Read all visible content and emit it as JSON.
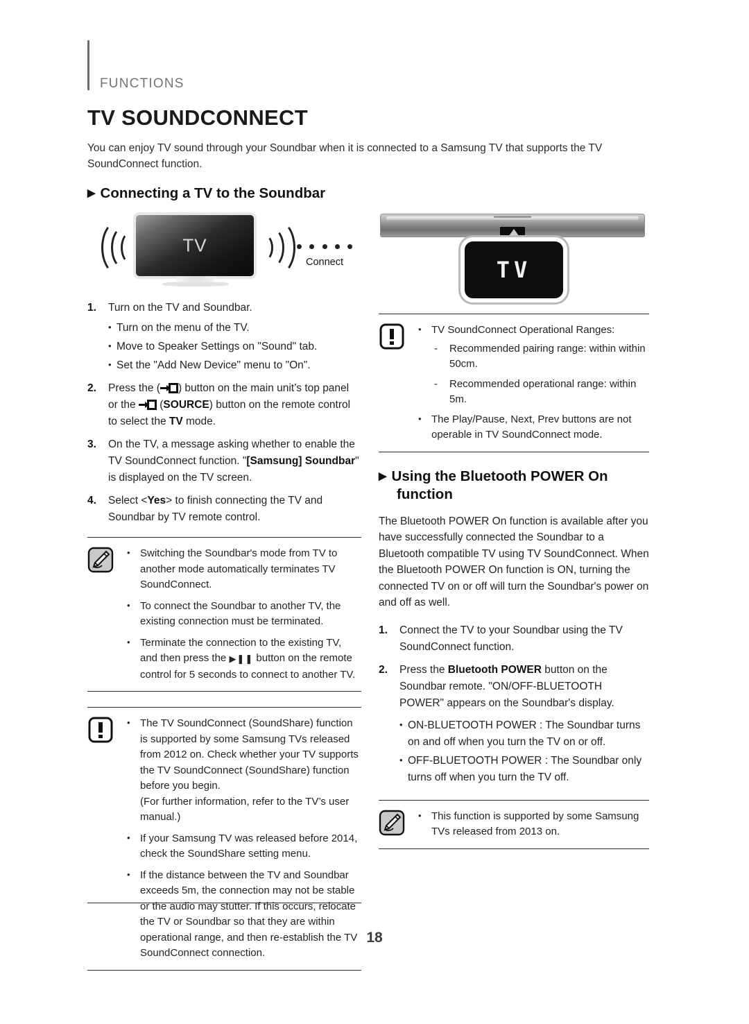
{
  "header": {
    "section_label": "FUNCTIONS",
    "page_title": "TV SOUNDCONNECT",
    "intro": "You can enjoy TV sound through your Soundbar when it is connected to a Samsung TV that supports the TV SoundConnect function."
  },
  "sections": {
    "connecting": {
      "heading": "Connecting a TV to the Soundbar"
    },
    "bluetooth_power": {
      "heading_line1": "Using the Bluetooth POWER On",
      "heading_line2": "function",
      "paragraph": "The Bluetooth POWER On function is available after you have successfully connected the Soundbar to a Bluetooth compatible TV using TV SoundConnect. When the Bluetooth POWER On function is ON, turning the connected TV on or off will turn the Soundbar's power on and off as well."
    }
  },
  "illustrations": {
    "tv": {
      "screen_label": "TV",
      "connect_label": "Connect",
      "dots_count": 5
    },
    "soundbar": {
      "display_text": "TV"
    }
  },
  "left_steps": [
    {
      "num": "1.",
      "text": "Turn on the TV and Soundbar.",
      "subs": [
        "Turn on the menu of the TV.",
        "Move to Speaker Settings on \"Sound\" tab.",
        "Set the \"Add New Device\" menu to \"On\"."
      ]
    },
    {
      "num": "2.",
      "text_part1": "Press the (",
      "text_part2": ") button on the main unit’s top panel or the ",
      "text_part3": " (",
      "bold_source": "SOURCE",
      "text_part4": ") button on the remote control to select the ",
      "bold_tv": "TV",
      "text_part5": " mode."
    },
    {
      "num": "3.",
      "text_part1": "On the TV, a message asking whether to enable the TV SoundConnect function. \"",
      "bold1": "[Samsung] Soundbar",
      "text_part2": "\" is displayed on the TV screen."
    },
    {
      "num": "4.",
      "text_part1": "Select <",
      "bold1": "Yes",
      "text_part2": "> to finish connecting the TV and Soundbar by TV remote control."
    }
  ],
  "left_note": {
    "icon": "note-pencil-icon",
    "bullets": [
      "Switching the Soundbar's mode from TV to another mode automatically terminates TV SoundConnect.",
      "To connect the Soundbar to another TV, the existing connection must be terminated."
    ],
    "bullet3_part1": "Terminate the connection to the existing TV, and then press the ",
    "bullet3_symbol": "▶⏸",
    "bullet3_part2": " button on the remote control for 5 seconds to connect to another TV."
  },
  "left_caution": {
    "icon": "caution-exclamation-icon",
    "bullets": [
      "The TV SoundConnect (SoundShare) function is supported by some Samsung TVs released from 2012 on. Check whether your TV supports the TV SoundConnect (SoundShare) function before you begin.",
      "If your Samsung TV was released before 2014, check the SoundShare setting menu.",
      "If the distance between the TV and Soundbar exceeds 5m, the connection may not be stable or the audio may stutter. If this occurs, relocate the TV or Soundbar so that they are within operational range, and then re-establish the TV SoundConnect connection."
    ],
    "bullet1_extra_line": "(For further information, refer to the TV’s user manual.)"
  },
  "right_caution": {
    "icon": "caution-exclamation-icon",
    "bullet1": "TV SoundConnect Operational Ranges:",
    "dashes": [
      "Recommended pairing range: within within 50cm.",
      "Recommended operational range: within 5m."
    ],
    "bullet2": "The Play/Pause, Next, Prev buttons are not operable in TV SoundConnect mode."
  },
  "right_steps": [
    {
      "num": "1.",
      "text": "Connect the TV to your Soundbar using the TV SoundConnect function."
    },
    {
      "num": "2.",
      "text_part1": "Press the ",
      "bold1": "Bluetooth POWER",
      "text_part2": " button on the Soundbar remote. \"ON/OFF-BLUETOOTH POWER\" appears on the Soundbar's display."
    }
  ],
  "right_substeps": [
    "ON-BLUETOOTH POWER : The Soundbar turns on and off when you turn the TV on or off.",
    "OFF-BLUETOOTH POWER : The Soundbar only turns off when you turn the TV off."
  ],
  "right_note": {
    "icon": "note-pencil-icon",
    "bullet": "This function is supported by some Samsung TVs released from 2013 on."
  },
  "footer": {
    "page_number": "18"
  },
  "colors": {
    "text": "#232323",
    "heading": "#111111",
    "muted": "#747474",
    "rule": "#2b2b2b"
  }
}
